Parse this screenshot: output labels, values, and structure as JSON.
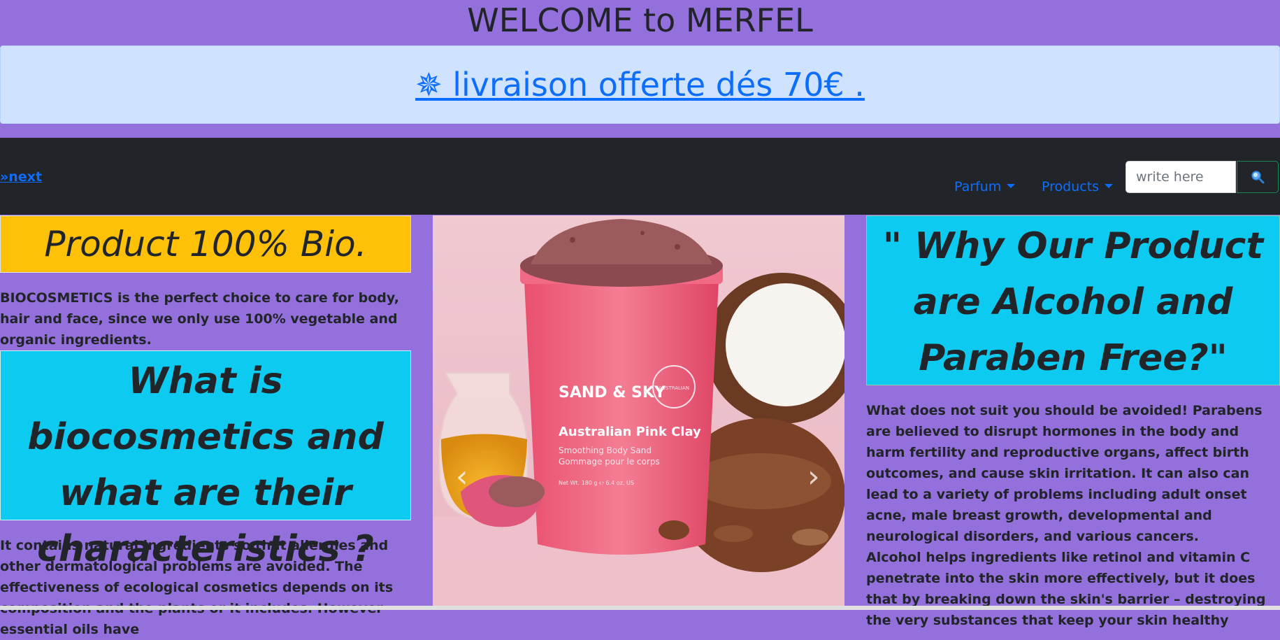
{
  "header": {
    "welcome": "WELCOME to MERFEL",
    "promo_icon": "compass-star-icon",
    "promo_text": "✵ livraison offerte dés 70€ ."
  },
  "navbar": {
    "next_link": "»next",
    "items": [
      {
        "label": "Parfum"
      },
      {
        "label": "Products"
      }
    ],
    "search": {
      "placeholder": "write here",
      "button_icon": "magnifier-icon"
    }
  },
  "left_column": {
    "bio_title": "Product 100% Bio.",
    "bio_text": "BIOCOSMETICS is the perfect choice to care for body, hair and face, since we only use 100% vegetable and organic ingredients.",
    "question_title": "What is biocosmetics and what are their characteristics ?",
    "question_text": "It contains natural ingredients so that allergies and other dermatological problems are avoided. The effectiveness of ecological cosmetics depends on its composition and the plants or it includes. However essential oils have"
  },
  "carousel": {
    "product_brand": "SAND & SKY",
    "product_name": "Australian Pink Clay",
    "product_sub": "Smoothing Body Sand",
    "product_sub_fr": "Gommage pour le corps",
    "product_weight": "Net Wt. 180 g ℮ 6.4 oz. US",
    "seal_text": "AUSTRALIAN",
    "prev_icon": "chevron-left-icon",
    "next_icon": "chevron-right-icon"
  },
  "right_column": {
    "title": "\" Why Our Product are Alcohol and Paraben Free?\"",
    "para1": "What does not suit you should be avoided! Parabens are believed to disrupt hormones in the body and harm fertility and reproductive organs, affect birth outcomes, and cause skin irritation. It can also can lead to a variety of problems including adult onset acne, male breast growth, developmental and neurological disorders, and various cancers.",
    "para2": "Alcohol helps ingredients like retinol and vitamin C penetrate into the skin more effectively, but it does that by breaking down the skin's barrier – destroying the very substances that keep your skin healthy"
  },
  "colors": {
    "page_bg": "#9370db",
    "navbar_bg": "#212529",
    "link": "#0d6efd",
    "promo_bg": "#cfe2ff",
    "yellow_box": "#ffc107",
    "cyan_box": "#0dcaf0"
  }
}
